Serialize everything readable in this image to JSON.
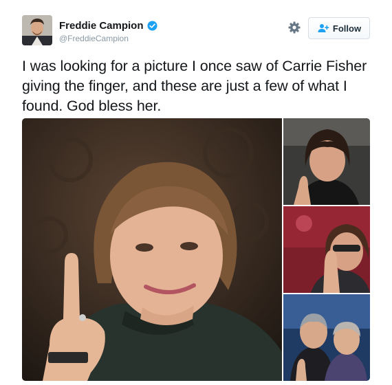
{
  "tweet": {
    "author": {
      "display_name": "Freddie Campion",
      "handle": "@FreddieCampion",
      "verified": true
    },
    "follow_label": "Follow",
    "text": "I was looking for a picture I once saw of Carrie Fisher giving the finger, and these are just a few of what I found. God bless her.",
    "media_count": 4
  },
  "colors": {
    "verified_blue": "#1da1f2",
    "follow_icon_blue": "#1da1f2",
    "handle_gray": "#8899a6"
  },
  "icons": {
    "settings": "gear-icon",
    "follow": "add-user-icon",
    "verified": "verified-badge-icon"
  }
}
